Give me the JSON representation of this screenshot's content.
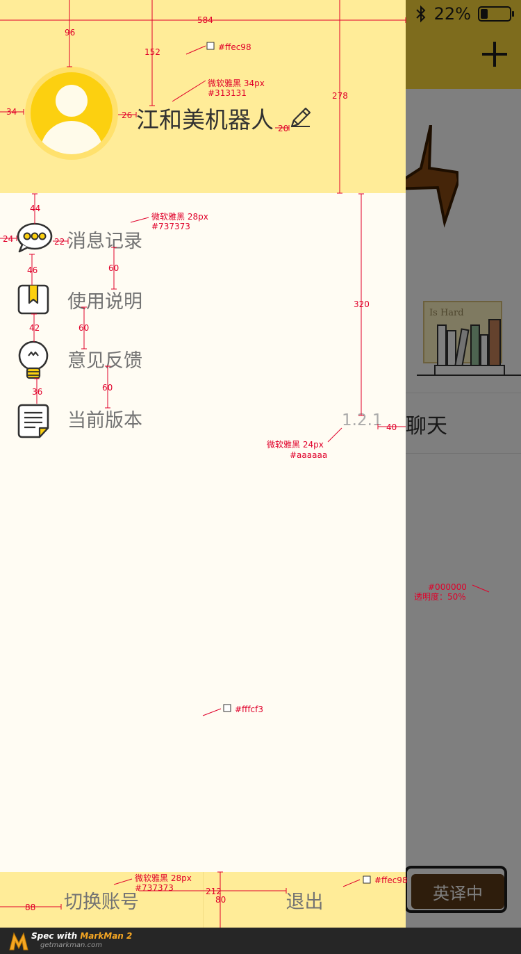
{
  "status_bar": {
    "battery_text": "22%",
    "battery_level": 0.22,
    "icon": "bluetooth-icon"
  },
  "background_screen": {
    "add_icon": "plus-icon",
    "book_title": "Is Hard",
    "row_text": "聊天",
    "translate_button": "英译中"
  },
  "drawer": {
    "colors": {
      "header_bg": "#ffec98",
      "body_bg": "#fffcf3",
      "footer_bg": "#ffec98",
      "name_color": "#313131",
      "menu_text_color": "#737373",
      "version_color": "#aaaaaa"
    },
    "user": {
      "name": "江和美机器人",
      "avatar_icon": "user-avatar-icon",
      "edit_icon": "pencil-icon"
    },
    "menu": [
      {
        "label": "消息记录",
        "icon": "chat-bubble-icon"
      },
      {
        "label": "使用说明",
        "icon": "bookmark-book-icon"
      },
      {
        "label": "意见反馈",
        "icon": "lightbulb-icon"
      },
      {
        "label": "当前版本",
        "icon": "document-note-icon",
        "value": "1.2.1"
      }
    ],
    "footer": {
      "switch_account": "切换账号",
      "logout": "退出"
    }
  },
  "overlay": {
    "color": "#000000",
    "opacity_text": "透明度：50%"
  },
  "annotations": {
    "dims": [
      "584",
      "96",
      "152",
      "278",
      "34",
      "26",
      "20",
      "44",
      "24",
      "22",
      "46",
      "60",
      "42",
      "60",
      "36",
      "60",
      "320",
      "40",
      "88",
      "212",
      "80"
    ],
    "specs": {
      "header_color": "#ffec98",
      "name_font": "微软雅黑 34px",
      "name_color": "#313131",
      "menu_font": "微软雅黑 28px",
      "menu_color": "#737373",
      "version_font": "微软雅黑 24px",
      "version_color": "#aaaaaa",
      "overlay_color": "#000000",
      "overlay_opacity": "透明度：50%",
      "body_color": "#fffcf3",
      "footer_font": "微软雅黑 28px",
      "footer_text_color": "#737373",
      "footer_color": "#ffec98"
    }
  },
  "markman": {
    "prefix": "Spec with ",
    "brand": "MarkMan 2",
    "url": "getmarkman.com"
  }
}
